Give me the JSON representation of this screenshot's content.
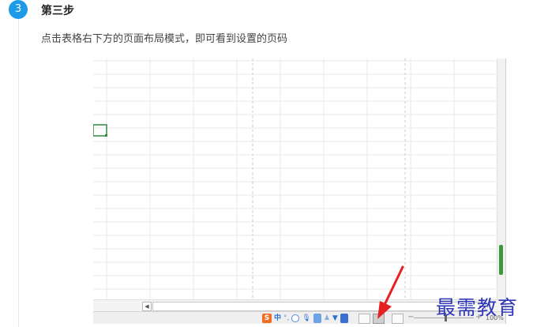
{
  "step": {
    "number": "3",
    "title": "第三步",
    "description": "点击表格右下方的页面布局模式，即可看到设置的页码"
  },
  "status_bar": {
    "ime_logo": "S",
    "ime_mode": "中",
    "zoom_minus": "−",
    "zoom_plus": "+",
    "zoom_level": "100%"
  },
  "watermark": "最需教育",
  "colors": {
    "accent": "#1e9be8",
    "arrow": "#e62020",
    "watermark": "#2f36b8"
  },
  "icons": [
    "sogou-ime-icon",
    "punctuation-icon",
    "emoji-icon",
    "voice-icon",
    "keyboard-icon",
    "person-icon",
    "shirt-icon",
    "toolbox-icon",
    "normal-view-icon",
    "page-layout-view-icon",
    "page-break-view-icon"
  ]
}
